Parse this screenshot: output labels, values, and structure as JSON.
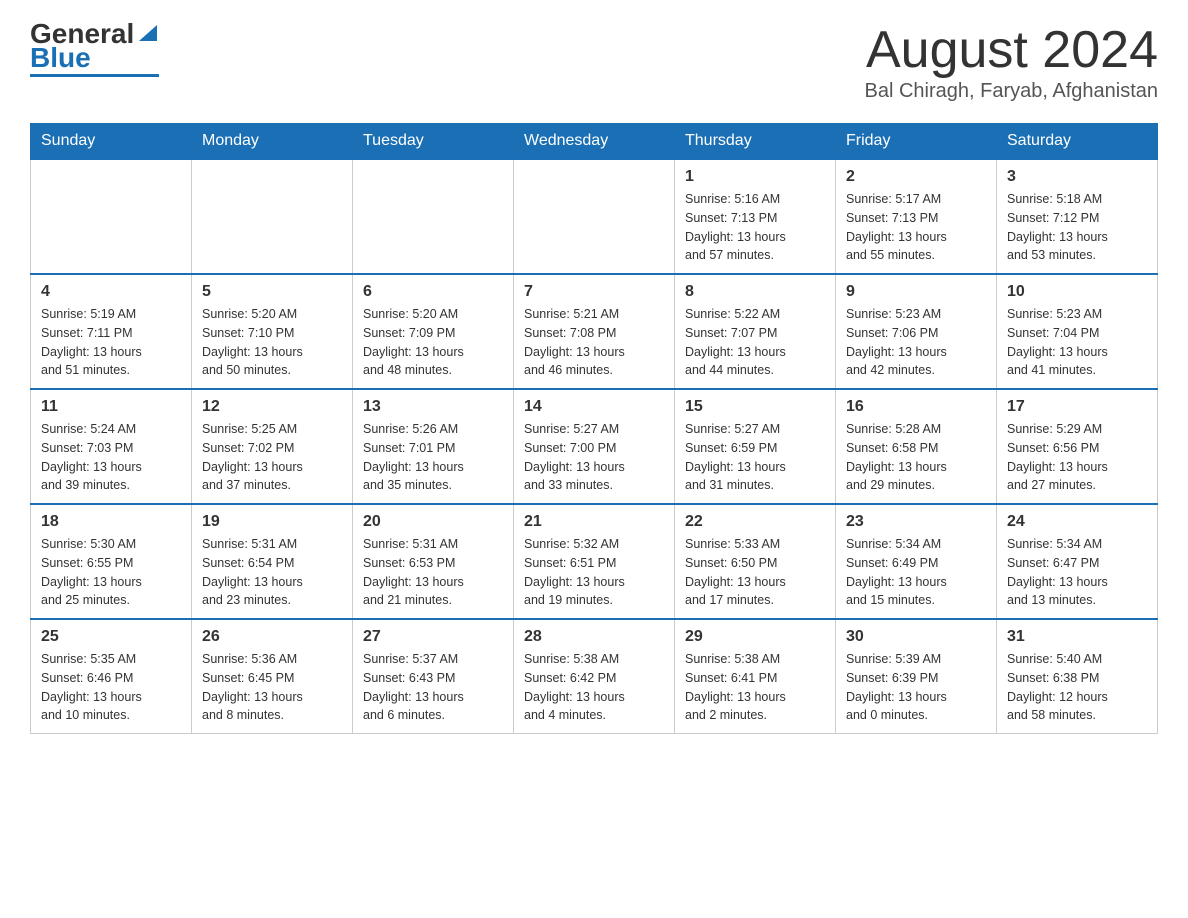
{
  "logo": {
    "general": "General",
    "blue": "Blue"
  },
  "title": "August 2024",
  "location": "Bal Chiragh, Faryab, Afghanistan",
  "days_of_week": [
    "Sunday",
    "Monday",
    "Tuesday",
    "Wednesday",
    "Thursday",
    "Friday",
    "Saturday"
  ],
  "weeks": [
    [
      {
        "day": "",
        "info": ""
      },
      {
        "day": "",
        "info": ""
      },
      {
        "day": "",
        "info": ""
      },
      {
        "day": "",
        "info": ""
      },
      {
        "day": "1",
        "info": "Sunrise: 5:16 AM\nSunset: 7:13 PM\nDaylight: 13 hours\nand 57 minutes."
      },
      {
        "day": "2",
        "info": "Sunrise: 5:17 AM\nSunset: 7:13 PM\nDaylight: 13 hours\nand 55 minutes."
      },
      {
        "day": "3",
        "info": "Sunrise: 5:18 AM\nSunset: 7:12 PM\nDaylight: 13 hours\nand 53 minutes."
      }
    ],
    [
      {
        "day": "4",
        "info": "Sunrise: 5:19 AM\nSunset: 7:11 PM\nDaylight: 13 hours\nand 51 minutes."
      },
      {
        "day": "5",
        "info": "Sunrise: 5:20 AM\nSunset: 7:10 PM\nDaylight: 13 hours\nand 50 minutes."
      },
      {
        "day": "6",
        "info": "Sunrise: 5:20 AM\nSunset: 7:09 PM\nDaylight: 13 hours\nand 48 minutes."
      },
      {
        "day": "7",
        "info": "Sunrise: 5:21 AM\nSunset: 7:08 PM\nDaylight: 13 hours\nand 46 minutes."
      },
      {
        "day": "8",
        "info": "Sunrise: 5:22 AM\nSunset: 7:07 PM\nDaylight: 13 hours\nand 44 minutes."
      },
      {
        "day": "9",
        "info": "Sunrise: 5:23 AM\nSunset: 7:06 PM\nDaylight: 13 hours\nand 42 minutes."
      },
      {
        "day": "10",
        "info": "Sunrise: 5:23 AM\nSunset: 7:04 PM\nDaylight: 13 hours\nand 41 minutes."
      }
    ],
    [
      {
        "day": "11",
        "info": "Sunrise: 5:24 AM\nSunset: 7:03 PM\nDaylight: 13 hours\nand 39 minutes."
      },
      {
        "day": "12",
        "info": "Sunrise: 5:25 AM\nSunset: 7:02 PM\nDaylight: 13 hours\nand 37 minutes."
      },
      {
        "day": "13",
        "info": "Sunrise: 5:26 AM\nSunset: 7:01 PM\nDaylight: 13 hours\nand 35 minutes."
      },
      {
        "day": "14",
        "info": "Sunrise: 5:27 AM\nSunset: 7:00 PM\nDaylight: 13 hours\nand 33 minutes."
      },
      {
        "day": "15",
        "info": "Sunrise: 5:27 AM\nSunset: 6:59 PM\nDaylight: 13 hours\nand 31 minutes."
      },
      {
        "day": "16",
        "info": "Sunrise: 5:28 AM\nSunset: 6:58 PM\nDaylight: 13 hours\nand 29 minutes."
      },
      {
        "day": "17",
        "info": "Sunrise: 5:29 AM\nSunset: 6:56 PM\nDaylight: 13 hours\nand 27 minutes."
      }
    ],
    [
      {
        "day": "18",
        "info": "Sunrise: 5:30 AM\nSunset: 6:55 PM\nDaylight: 13 hours\nand 25 minutes."
      },
      {
        "day": "19",
        "info": "Sunrise: 5:31 AM\nSunset: 6:54 PM\nDaylight: 13 hours\nand 23 minutes."
      },
      {
        "day": "20",
        "info": "Sunrise: 5:31 AM\nSunset: 6:53 PM\nDaylight: 13 hours\nand 21 minutes."
      },
      {
        "day": "21",
        "info": "Sunrise: 5:32 AM\nSunset: 6:51 PM\nDaylight: 13 hours\nand 19 minutes."
      },
      {
        "day": "22",
        "info": "Sunrise: 5:33 AM\nSunset: 6:50 PM\nDaylight: 13 hours\nand 17 minutes."
      },
      {
        "day": "23",
        "info": "Sunrise: 5:34 AM\nSunset: 6:49 PM\nDaylight: 13 hours\nand 15 minutes."
      },
      {
        "day": "24",
        "info": "Sunrise: 5:34 AM\nSunset: 6:47 PM\nDaylight: 13 hours\nand 13 minutes."
      }
    ],
    [
      {
        "day": "25",
        "info": "Sunrise: 5:35 AM\nSunset: 6:46 PM\nDaylight: 13 hours\nand 10 minutes."
      },
      {
        "day": "26",
        "info": "Sunrise: 5:36 AM\nSunset: 6:45 PM\nDaylight: 13 hours\nand 8 minutes."
      },
      {
        "day": "27",
        "info": "Sunrise: 5:37 AM\nSunset: 6:43 PM\nDaylight: 13 hours\nand 6 minutes."
      },
      {
        "day": "28",
        "info": "Sunrise: 5:38 AM\nSunset: 6:42 PM\nDaylight: 13 hours\nand 4 minutes."
      },
      {
        "day": "29",
        "info": "Sunrise: 5:38 AM\nSunset: 6:41 PM\nDaylight: 13 hours\nand 2 minutes."
      },
      {
        "day": "30",
        "info": "Sunrise: 5:39 AM\nSunset: 6:39 PM\nDaylight: 13 hours\nand 0 minutes."
      },
      {
        "day": "31",
        "info": "Sunrise: 5:40 AM\nSunset: 6:38 PM\nDaylight: 12 hours\nand 58 minutes."
      }
    ]
  ]
}
